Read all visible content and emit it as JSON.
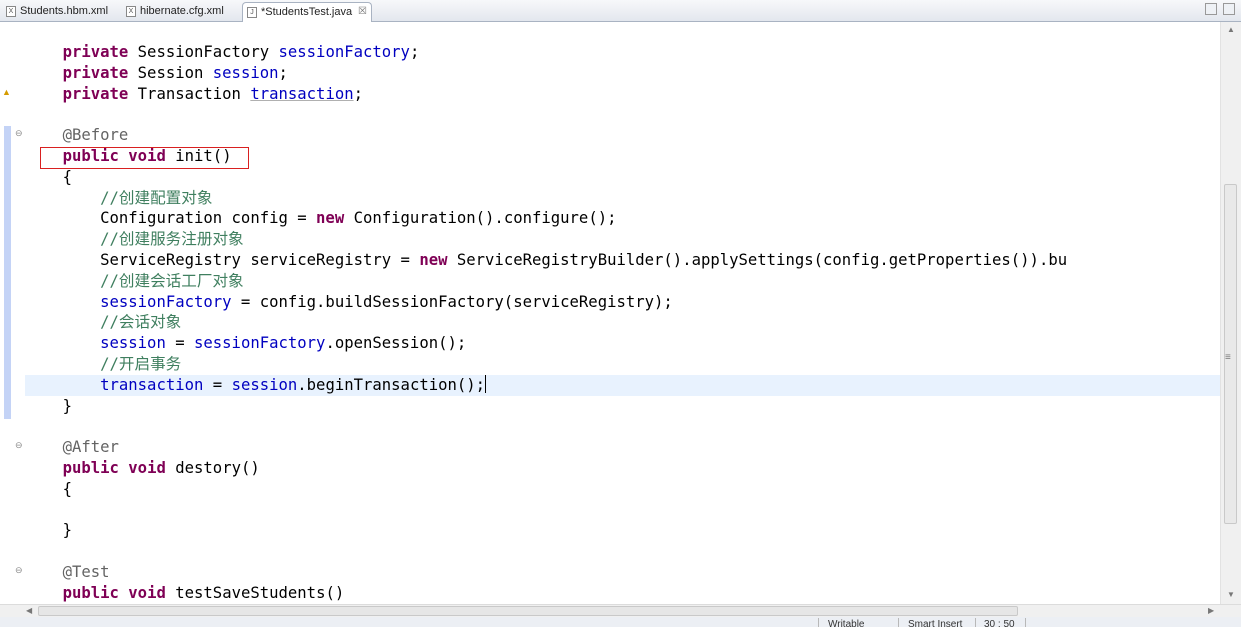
{
  "tabs": [
    {
      "label": "Students.hbm.xml",
      "icon": "xml-file-icon"
    },
    {
      "label": "hibernate.cfg.xml",
      "icon": "xml-file-icon"
    },
    {
      "label": "*StudentsTest.java",
      "icon": "java-file-icon",
      "active": true,
      "close": "☒"
    }
  ],
  "code": {
    "l1": [
      "private",
      "SessionFactory",
      "sessionFactory",
      ";"
    ],
    "l2": [
      "private",
      "Session",
      "session",
      ";"
    ],
    "l3": [
      "private",
      "Transaction",
      "transaction",
      ";"
    ],
    "l5": "@Before",
    "l6": [
      "public",
      "void",
      "init()"
    ],
    "l7": "{",
    "l8": "//创建配置对象",
    "l9": [
      "Configuration config = ",
      "new",
      " Configuration().configure();"
    ],
    "l10": "//创建服务注册对象",
    "l11": [
      "ServiceRegistry serviceRegistry = ",
      "new",
      " ServiceRegistryBuilder().applySettings(config.getProperties()).bu"
    ],
    "l12": "//创建会话工厂对象",
    "l13": [
      "sessionFactory",
      " = config.buildSessionFactory(serviceRegistry);"
    ],
    "l14": "//会话对象",
    "l15": [
      "session",
      " = ",
      "sessionFactory",
      ".openSession();"
    ],
    "l16": "//开启事务",
    "l17": [
      "transaction",
      " = ",
      "session",
      ".beginTransaction();"
    ],
    "l18": "}",
    "l20": "@After",
    "l21": [
      "public",
      "void",
      "destory()"
    ],
    "l22": "{",
    "l24": "}",
    "l26": "@Test",
    "l27": [
      "public",
      "void",
      "testSaveStudents()"
    ]
  },
  "status": {
    "writable": "Writable",
    "insert_mode": "Smart Insert",
    "position": "30 : 50"
  },
  "colors": {
    "keyword": "#7f0055",
    "field": "#0000c0",
    "annotation": "#646464",
    "comment": "#3f7f5f",
    "highlight_box": "#d92020"
  }
}
